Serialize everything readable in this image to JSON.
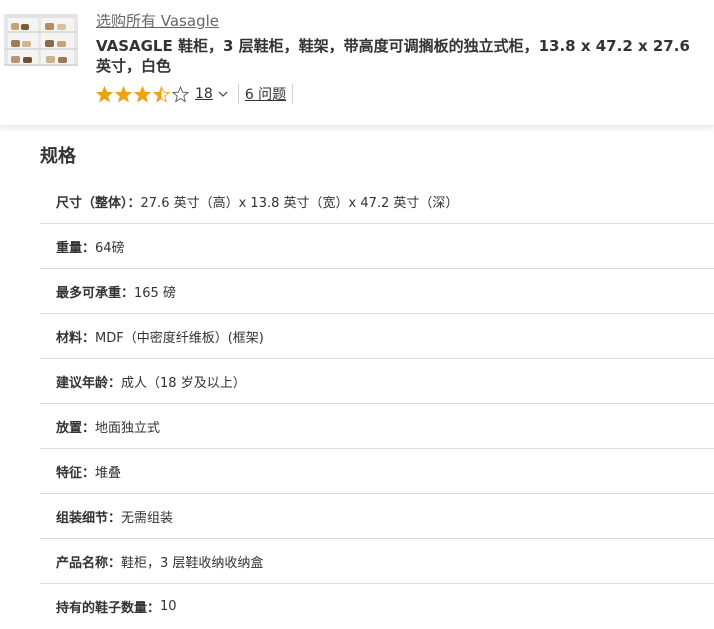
{
  "header": {
    "brand_link": "选购所有 Vasagle",
    "title": "VASAGLE 鞋柜，3 层鞋柜，鞋架，带高度可调搁板的独立式柜，13.8 x 47.2 x 27.6 英寸，白色",
    "rating": {
      "stars": 3.5,
      "max_stars": 5,
      "review_count": "18",
      "questions_link": "6 问题"
    }
  },
  "colors": {
    "star_fill": "#e8a317",
    "text": "#333333",
    "muted": "#666666",
    "divider": "#dcdcdc"
  },
  "specs": {
    "title": "规格",
    "rows": [
      {
        "key": "尺寸（整体）：",
        "value": "27.6 英寸（高）x 13.8 英寸（宽）x 47.2 英寸（深）"
      },
      {
        "key": "重量：",
        "value": "64磅"
      },
      {
        "key": "最多可承重：",
        "value": "165 磅"
      },
      {
        "key": "材料：",
        "value": "MDF（中密度纤维板）(框架)"
      },
      {
        "key": "建议年龄：",
        "value": "成人（18 岁及以上）"
      },
      {
        "key": "放置：",
        "value": "地面独立式"
      },
      {
        "key": "特征：",
        "value": "堆叠"
      },
      {
        "key": "组装细节：",
        "value": "无需组装"
      },
      {
        "key": "产品名称：",
        "value": "鞋柜，3 层鞋收纳收纳盒"
      },
      {
        "key": "持有的鞋子数量：",
        "value": "10"
      }
    ]
  }
}
